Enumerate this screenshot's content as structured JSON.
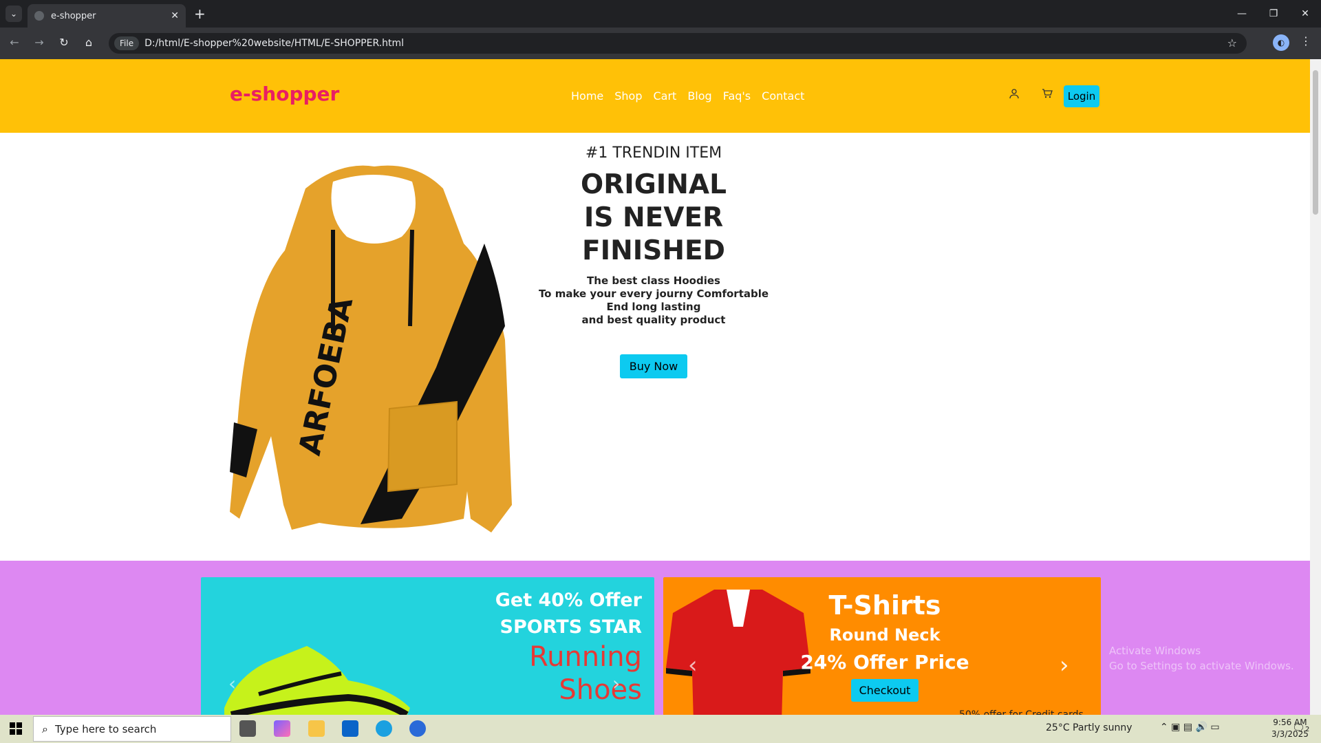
{
  "browser": {
    "tab_title": "e-shopper",
    "new_tab": "+",
    "url_chip": "File",
    "url": "D:/html/E-shopper%20website/HTML/E-SHOPPER.html"
  },
  "site": {
    "logo": "e-shopper",
    "nav": [
      "Home",
      "Shop",
      "Cart",
      "Blog",
      "Faq's",
      "Contact"
    ],
    "login": "Login"
  },
  "hero": {
    "kicker": "#1 TRENDIN ITEM",
    "title_lines": [
      "ORIGINAL",
      "IS NEVER",
      "FINISHED"
    ],
    "desc_lines": [
      "The best class Hoodies",
      "To make your every journy Comfortable",
      "End long lasting",
      "and best quality product"
    ],
    "button": "Buy Now"
  },
  "promo_shoes": {
    "line1": "Get 40% Offer",
    "line2": "SPORTS STAR",
    "line3": "Running",
    "line4": "Shoes"
  },
  "promo_tshirt": {
    "title": "T-Shirts",
    "sub": "Round Neck",
    "offer": "24% Offer Price",
    "button": "Checkout",
    "note": "50% offer for Credit cards"
  },
  "watermark": {
    "line1": "Activate Windows",
    "line2": "Go to Settings to activate Windows."
  },
  "taskbar": {
    "search_placeholder": "Type here to search",
    "weather": "25°C  Partly sunny",
    "time": "9:56 AM",
    "date": "3/3/2025",
    "notif_count": "2"
  },
  "colors": {
    "header_bg": "#ffc107",
    "logo": "#e91e63",
    "accent_button": "#0dcaf0",
    "promo_bg": "#dd88f2",
    "shoes_card": "#23d3dd",
    "tshirt_card": "#ff8c00"
  }
}
